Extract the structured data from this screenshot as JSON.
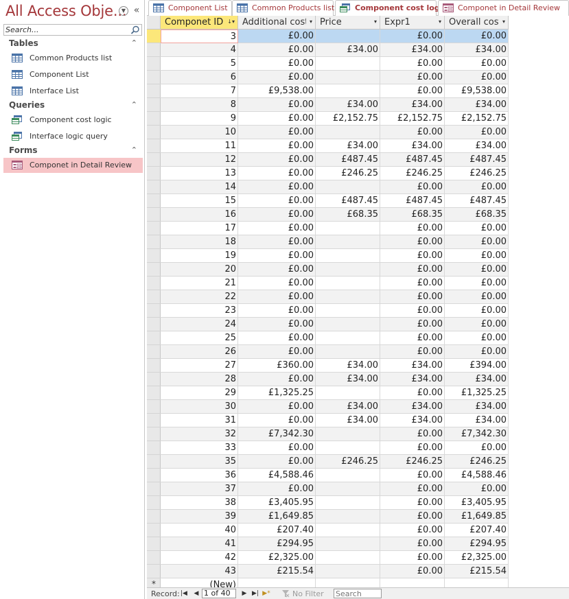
{
  "nav": {
    "title": "All Access Obje...",
    "search_placeholder": "Search...",
    "groups": [
      {
        "label": "Tables",
        "items": [
          {
            "label": "Common Products list",
            "icon": "table-icon"
          },
          {
            "label": "Component List",
            "icon": "table-icon"
          },
          {
            "label": "Interface List",
            "icon": "table-icon"
          }
        ]
      },
      {
        "label": "Queries",
        "items": [
          {
            "label": "Component cost logic",
            "icon": "query-icon"
          },
          {
            "label": "Interface logic query",
            "icon": "query-icon"
          }
        ]
      },
      {
        "label": "Forms",
        "items": [
          {
            "label": "Componet in Detail Review",
            "icon": "form-icon",
            "selected": true
          }
        ]
      }
    ]
  },
  "tabs": [
    {
      "label": "Component List",
      "icon": "table-icon"
    },
    {
      "label": "Common Products list",
      "icon": "table-icon"
    },
    {
      "label": "Component cost logic",
      "icon": "query-icon",
      "active": true
    },
    {
      "label": "Componet in Detail Review",
      "icon": "form-icon"
    }
  ],
  "datasheet": {
    "columns": [
      {
        "label": "Componet ID",
        "selected": true,
        "sort_indicator": "sort-asc-icon"
      },
      {
        "label": "Additional cost"
      },
      {
        "label": "Price"
      },
      {
        "label": "Expr1"
      },
      {
        "label": "Overall cost"
      }
    ],
    "rows": [
      [
        "3",
        "£0.00",
        "",
        "£0.00",
        "£0.00"
      ],
      [
        "4",
        "£0.00",
        "£34.00",
        "£34.00",
        "£34.00"
      ],
      [
        "5",
        "£0.00",
        "",
        "£0.00",
        "£0.00"
      ],
      [
        "6",
        "£0.00",
        "",
        "£0.00",
        "£0.00"
      ],
      [
        "7",
        "£9,538.00",
        "",
        "£0.00",
        "£9,538.00"
      ],
      [
        "8",
        "£0.00",
        "£34.00",
        "£34.00",
        "£34.00"
      ],
      [
        "9",
        "£0.00",
        "£2,152.75",
        "£2,152.75",
        "£2,152.75"
      ],
      [
        "10",
        "£0.00",
        "",
        "£0.00",
        "£0.00"
      ],
      [
        "11",
        "£0.00",
        "£34.00",
        "£34.00",
        "£34.00"
      ],
      [
        "12",
        "£0.00",
        "£487.45",
        "£487.45",
        "£487.45"
      ],
      [
        "13",
        "£0.00",
        "£246.25",
        "£246.25",
        "£246.25"
      ],
      [
        "14",
        "£0.00",
        "",
        "£0.00",
        "£0.00"
      ],
      [
        "15",
        "£0.00",
        "£487.45",
        "£487.45",
        "£487.45"
      ],
      [
        "16",
        "£0.00",
        "£68.35",
        "£68.35",
        "£68.35"
      ],
      [
        "17",
        "£0.00",
        "",
        "£0.00",
        "£0.00"
      ],
      [
        "18",
        "£0.00",
        "",
        "£0.00",
        "£0.00"
      ],
      [
        "19",
        "£0.00",
        "",
        "£0.00",
        "£0.00"
      ],
      [
        "20",
        "£0.00",
        "",
        "£0.00",
        "£0.00"
      ],
      [
        "21",
        "£0.00",
        "",
        "£0.00",
        "£0.00"
      ],
      [
        "22",
        "£0.00",
        "",
        "£0.00",
        "£0.00"
      ],
      [
        "23",
        "£0.00",
        "",
        "£0.00",
        "£0.00"
      ],
      [
        "24",
        "£0.00",
        "",
        "£0.00",
        "£0.00"
      ],
      [
        "25",
        "£0.00",
        "",
        "£0.00",
        "£0.00"
      ],
      [
        "26",
        "£0.00",
        "",
        "£0.00",
        "£0.00"
      ],
      [
        "27",
        "£360.00",
        "£34.00",
        "£34.00",
        "£394.00"
      ],
      [
        "28",
        "£0.00",
        "£34.00",
        "£34.00",
        "£34.00"
      ],
      [
        "29",
        "£1,325.25",
        "",
        "£0.00",
        "£1,325.25"
      ],
      [
        "30",
        "£0.00",
        "£34.00",
        "£34.00",
        "£34.00"
      ],
      [
        "31",
        "£0.00",
        "£34.00",
        "£34.00",
        "£34.00"
      ],
      [
        "32",
        "£7,342.30",
        "",
        "£0.00",
        "£7,342.30"
      ],
      [
        "33",
        "£0.00",
        "",
        "£0.00",
        "£0.00"
      ],
      [
        "35",
        "£0.00",
        "£246.25",
        "£246.25",
        "£246.25"
      ],
      [
        "36",
        "£4,588.46",
        "",
        "£0.00",
        "£4,588.46"
      ],
      [
        "37",
        "£0.00",
        "",
        "£0.00",
        "£0.00"
      ],
      [
        "38",
        "£3,405.95",
        "",
        "£0.00",
        "£3,405.95"
      ],
      [
        "39",
        "£1,649.85",
        "",
        "£0.00",
        "£1,649.85"
      ],
      [
        "40",
        "£207.40",
        "",
        "£0.00",
        "£207.40"
      ],
      [
        "41",
        "£294.95",
        "",
        "£0.00",
        "£294.95"
      ],
      [
        "42",
        "£2,325.00",
        "",
        "£0.00",
        "£2,325.00"
      ],
      [
        "43",
        "£215.54",
        "",
        "£0.00",
        "£215.54"
      ]
    ],
    "new_row_label": "(New)",
    "new_row_marker": "*"
  },
  "record_nav": {
    "label": "Record:",
    "current": "1 of 40",
    "filter_label": "No Filter",
    "search_placeholder": "Search"
  },
  "colors": {
    "accent": "#a4373a",
    "selected_header": "#fce77a",
    "current_row": "#bcd8f2",
    "nav_selected": "#f7c5c7"
  }
}
